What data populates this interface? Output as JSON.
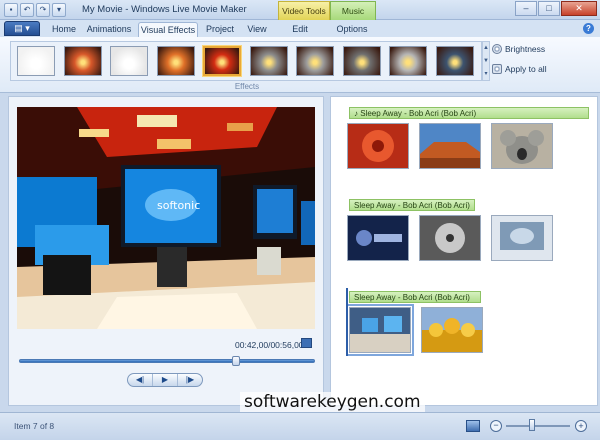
{
  "window": {
    "title": "My Movie - Windows Live Movie Maker",
    "context_tab_video": "Video Tools",
    "context_tab_music": "Music Tools",
    "minimize": "–",
    "maximize": "□",
    "close": "✕"
  },
  "tabs": [
    "Home",
    "Animations",
    "Visual Effects",
    "Project",
    "View",
    "Edit",
    "Options"
  ],
  "active_tab": "Visual Effects",
  "app_menu_label": "▤ ▾",
  "ribbon": {
    "brightness_label": "Brightness",
    "apply_all_label": "Apply to all",
    "group_label": "Effects",
    "effects": [
      {
        "name": "No effect",
        "icon": "blank-thumb",
        "color": "#f2f2f2"
      },
      {
        "name": "Sepia flower",
        "icon": "flower-thumb",
        "color": "#d8582a"
      },
      {
        "name": "White blur",
        "icon": "white-thumb",
        "color": "#e6e6e6"
      },
      {
        "name": "Warm flower",
        "icon": "flower-thumb",
        "color": "#e07028"
      },
      {
        "name": "Red flower (selected)",
        "icon": "flower-thumb",
        "color": "#d42c12"
      },
      {
        "name": "Gray blur",
        "icon": "gray-thumb",
        "color": "#8c8c8c"
      },
      {
        "name": "Gray flower",
        "icon": "gray-thumb",
        "color": "#9d9d9d"
      },
      {
        "name": "Dark flower",
        "icon": "gray-thumb",
        "color": "#6f6f6f"
      },
      {
        "name": "Light gray",
        "icon": "gray-thumb",
        "color": "#b5b5b5"
      },
      {
        "name": "Blue night",
        "icon": "blue-thumb",
        "color": "#3d5470"
      }
    ],
    "selected_effect_index": 4
  },
  "preview": {
    "time": "00:42,00/00:56,00",
    "seek_fraction": 0.73,
    "prev_frame": "◀|",
    "play": "▶",
    "next_frame": "|▶",
    "brand_text": "softonic"
  },
  "storyboard": {
    "music_label": "Sleep Away - Bob Acri (Bob Acri)",
    "rows": [
      {
        "clips": [
          {
            "name": "red flower",
            "color": "#d8442a"
          },
          {
            "name": "desert",
            "color": "#c26a2c"
          },
          {
            "name": "koala",
            "color": "#9a9a92"
          }
        ]
      },
      {
        "clips": [
          {
            "name": "softonic logo",
            "color": "#203b7a"
          },
          {
            "name": "softonic cd",
            "color": "#707070"
          },
          {
            "name": "computer screen",
            "color": "#9cb3c7"
          }
        ]
      },
      {
        "clips": [
          {
            "name": "office desks",
            "color": "#5e7fa8"
          },
          {
            "name": "tulips",
            "color": "#e6b024"
          }
        ]
      }
    ]
  },
  "status": {
    "item_text": "Item 7 of 8",
    "zoom_fraction": 0.38
  },
  "watermark": "softwarekeygen.com"
}
